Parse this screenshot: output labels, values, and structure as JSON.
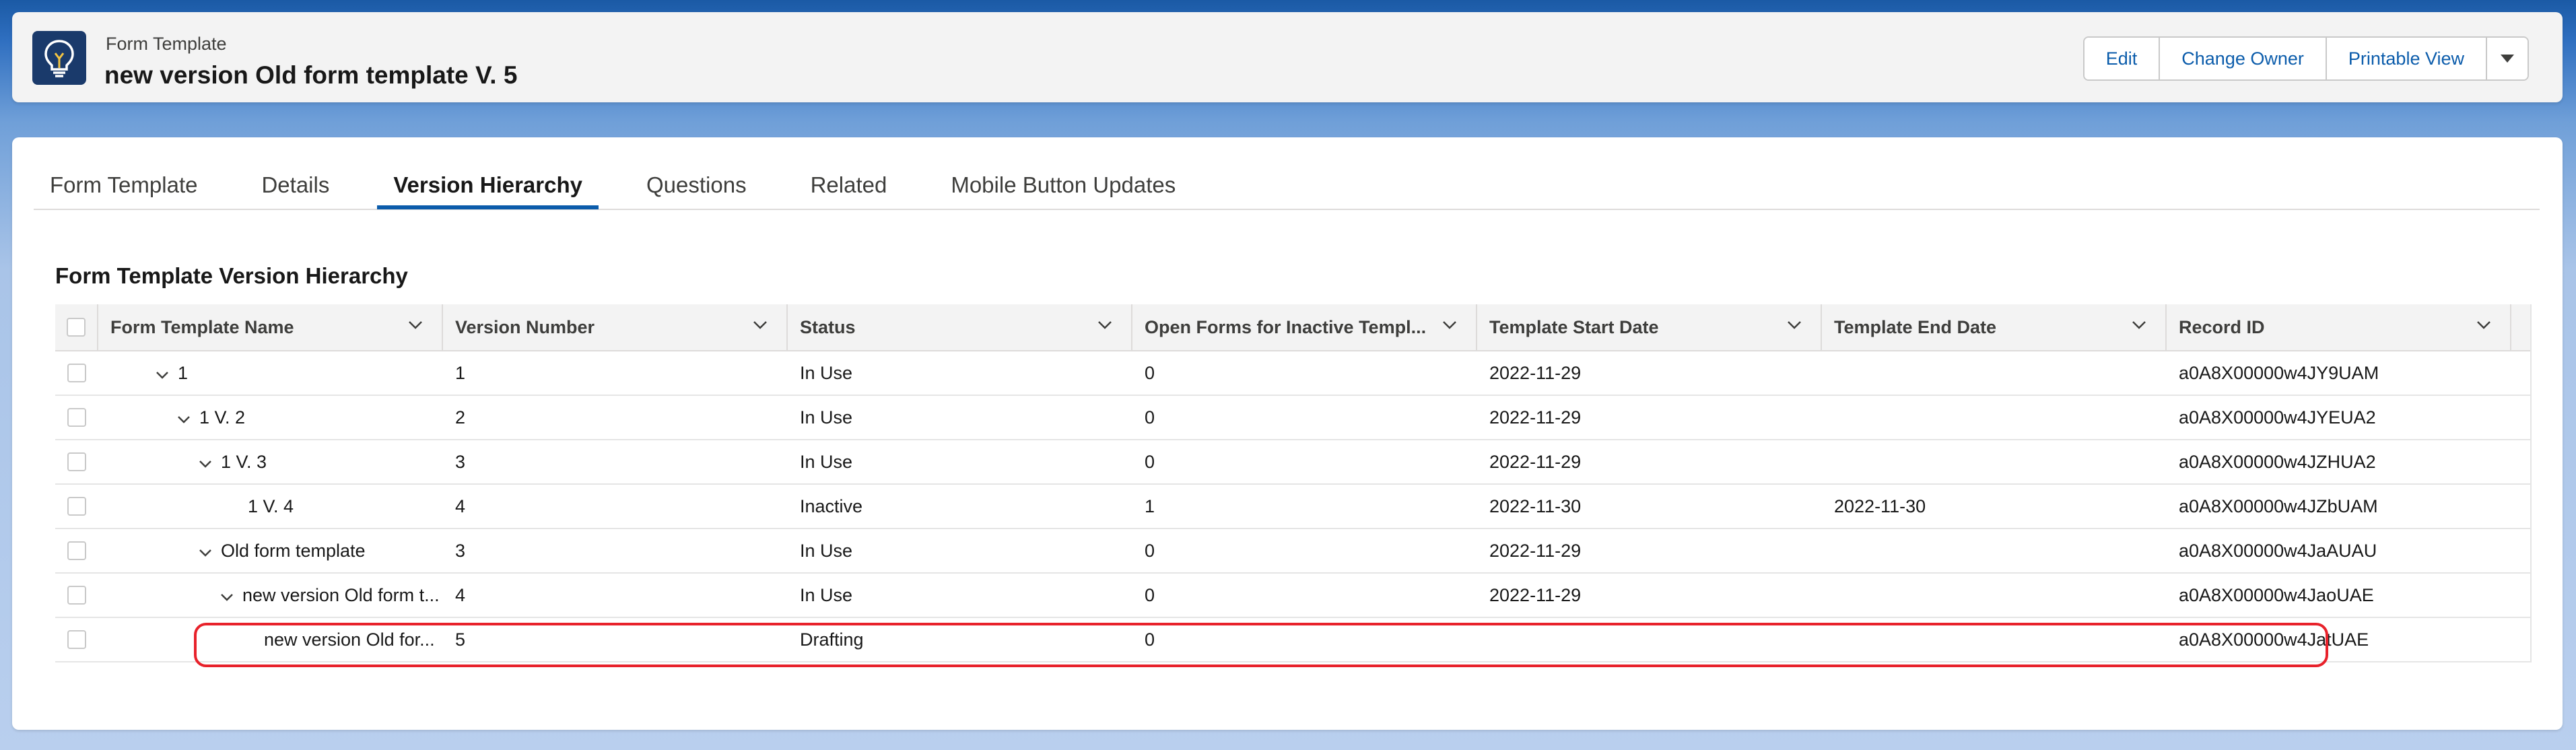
{
  "header": {
    "object_label": "Form Template",
    "record_title": "new version Old form template V. 5",
    "icon": "lightbulb-icon",
    "buttons": {
      "edit": "Edit",
      "change_owner": "Change Owner",
      "printable_view": "Printable View"
    },
    "more_icon": "chevron-down-icon"
  },
  "tabs": [
    "Form Template",
    "Details",
    "Version Hierarchy",
    "Questions",
    "Related",
    "Mobile Button Updates"
  ],
  "active_tab": "Version Hierarchy",
  "section_title": "Form Template Version Hierarchy",
  "columns": [
    "Form Template Name",
    "Version Number",
    "Status",
    "Open Forms for Inactive Templ...",
    "Template Start Date",
    "Template End Date",
    "Record ID"
  ],
  "rows": [
    {
      "name": "1",
      "expanded": true,
      "version": "1",
      "status": "In Use",
      "open_forms": "0",
      "start": "2022-11-29",
      "end": "",
      "record_id": "a0A8X00000w4JY9UAM"
    },
    {
      "name": "1 V. 2",
      "expanded": true,
      "version": "2",
      "status": "In Use",
      "open_forms": "0",
      "start": "2022-11-29",
      "end": "",
      "record_id": "a0A8X00000w4JYEUA2"
    },
    {
      "name": "1 V. 3",
      "expanded": true,
      "version": "3",
      "status": "In Use",
      "open_forms": "0",
      "start": "2022-11-29",
      "end": "",
      "record_id": "a0A8X00000w4JZHUA2"
    },
    {
      "name": "1 V. 4",
      "expanded": false,
      "version": "4",
      "status": "Inactive",
      "open_forms": "1",
      "start": "2022-11-30",
      "end": "2022-11-30",
      "record_id": "a0A8X00000w4JZbUAM"
    },
    {
      "name": "Old form template",
      "expanded": true,
      "version": "3",
      "status": "In Use",
      "open_forms": "0",
      "start": "2022-11-29",
      "end": "",
      "record_id": "a0A8X00000w4JaAUAU"
    },
    {
      "name": "new version Old form t...",
      "expanded": true,
      "version": "4",
      "status": "In Use",
      "open_forms": "0",
      "start": "2022-11-29",
      "end": "",
      "record_id": "a0A8X00000w4JaoUAE"
    },
    {
      "name": "new version Old for...",
      "expanded": false,
      "version": "5",
      "status": "Drafting",
      "open_forms": "0",
      "start": "",
      "end": "",
      "record_id": "a0A8X00000w4JatUAE"
    }
  ],
  "colors": {
    "accent": "#0b5cab",
    "highlight": "#e8222b",
    "icon_bg": "#1a3a6b"
  }
}
